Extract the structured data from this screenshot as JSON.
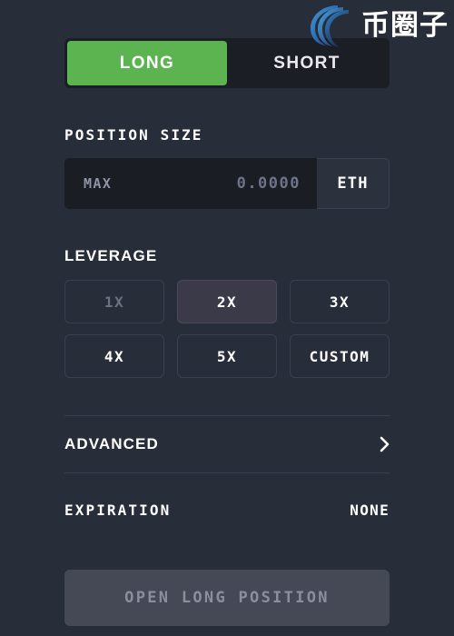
{
  "watermark": {
    "logo_icon": "spiral-swirl-logo",
    "text": "币圈子",
    "colors": {
      "light": "#3a8fd0",
      "mid": "#2b63a8",
      "dark": "#241f3e"
    }
  },
  "side_toggle": {
    "options": [
      {
        "label": "LONG",
        "active": true
      },
      {
        "label": "SHORT",
        "active": false
      }
    ],
    "active_color": "#5cb450"
  },
  "position_size": {
    "label": "POSITION SIZE",
    "max_label": "MAX",
    "amount_value": "",
    "amount_placeholder": "0.0000",
    "unit": "ETH"
  },
  "leverage": {
    "label": "LEVERAGE",
    "options": [
      {
        "label": "1X",
        "state": "disabled"
      },
      {
        "label": "2X",
        "state": "selected"
      },
      {
        "label": "3X",
        "state": "normal"
      },
      {
        "label": "4X",
        "state": "normal"
      },
      {
        "label": "5X",
        "state": "normal"
      },
      {
        "label": "CUSTOM",
        "state": "normal"
      }
    ]
  },
  "advanced": {
    "label": "ADVANCED",
    "chevron_icon": "chevron-right-icon"
  },
  "expiration": {
    "label": "EXPIRATION",
    "value": "NONE"
  },
  "submit": {
    "label": "OPEN LONG POSITION",
    "disabled": true
  }
}
